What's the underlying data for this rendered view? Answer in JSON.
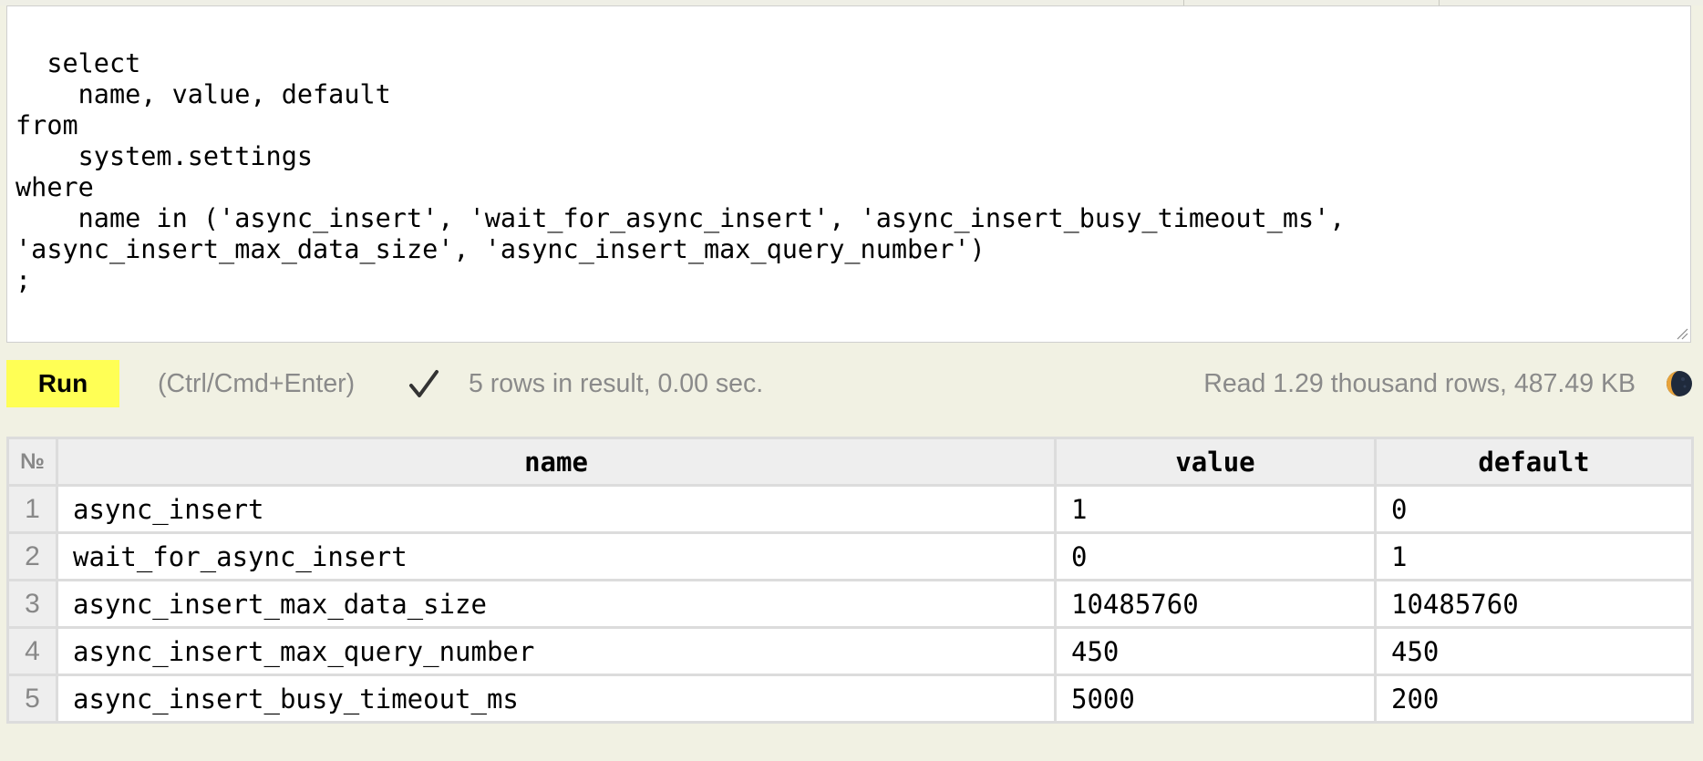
{
  "editor": {
    "query": "select\n    name, value, default\nfrom\n    system.settings\nwhere\n    name in ('async_insert', 'wait_for_async_insert', 'async_insert_busy_timeout_ms',\n'async_insert_max_data_size', 'async_insert_max_query_number')\n;"
  },
  "toolbar": {
    "run_label": "Run",
    "shortcut_hint": "(Ctrl/Cmd+Enter)",
    "status_icon": "checkmark-icon",
    "status_text": "5 rows in result, 0.00 sec.",
    "stats_text": "Read 1.29 thousand rows, 487.49 KB",
    "theme_icon": "moon-icon"
  },
  "results": {
    "number_header": "№",
    "columns": [
      "name",
      "value",
      "default"
    ],
    "rows": [
      {
        "num": "1",
        "name": "async_insert",
        "value": "1",
        "default": "0"
      },
      {
        "num": "2",
        "name": "wait_for_async_insert",
        "value": "0",
        "default": "1"
      },
      {
        "num": "3",
        "name": "async_insert_max_data_size",
        "value": "10485760",
        "default": "10485760"
      },
      {
        "num": "4",
        "name": "async_insert_max_query_number",
        "value": "450",
        "default": "450"
      },
      {
        "num": "5",
        "name": "async_insert_busy_timeout_ms",
        "value": "5000",
        "default": "200"
      }
    ]
  },
  "colors": {
    "background": "#f1f1e3",
    "run_button": "#ffff55",
    "muted_text": "#8a8a8a",
    "table_border": "#dcdcdc"
  }
}
